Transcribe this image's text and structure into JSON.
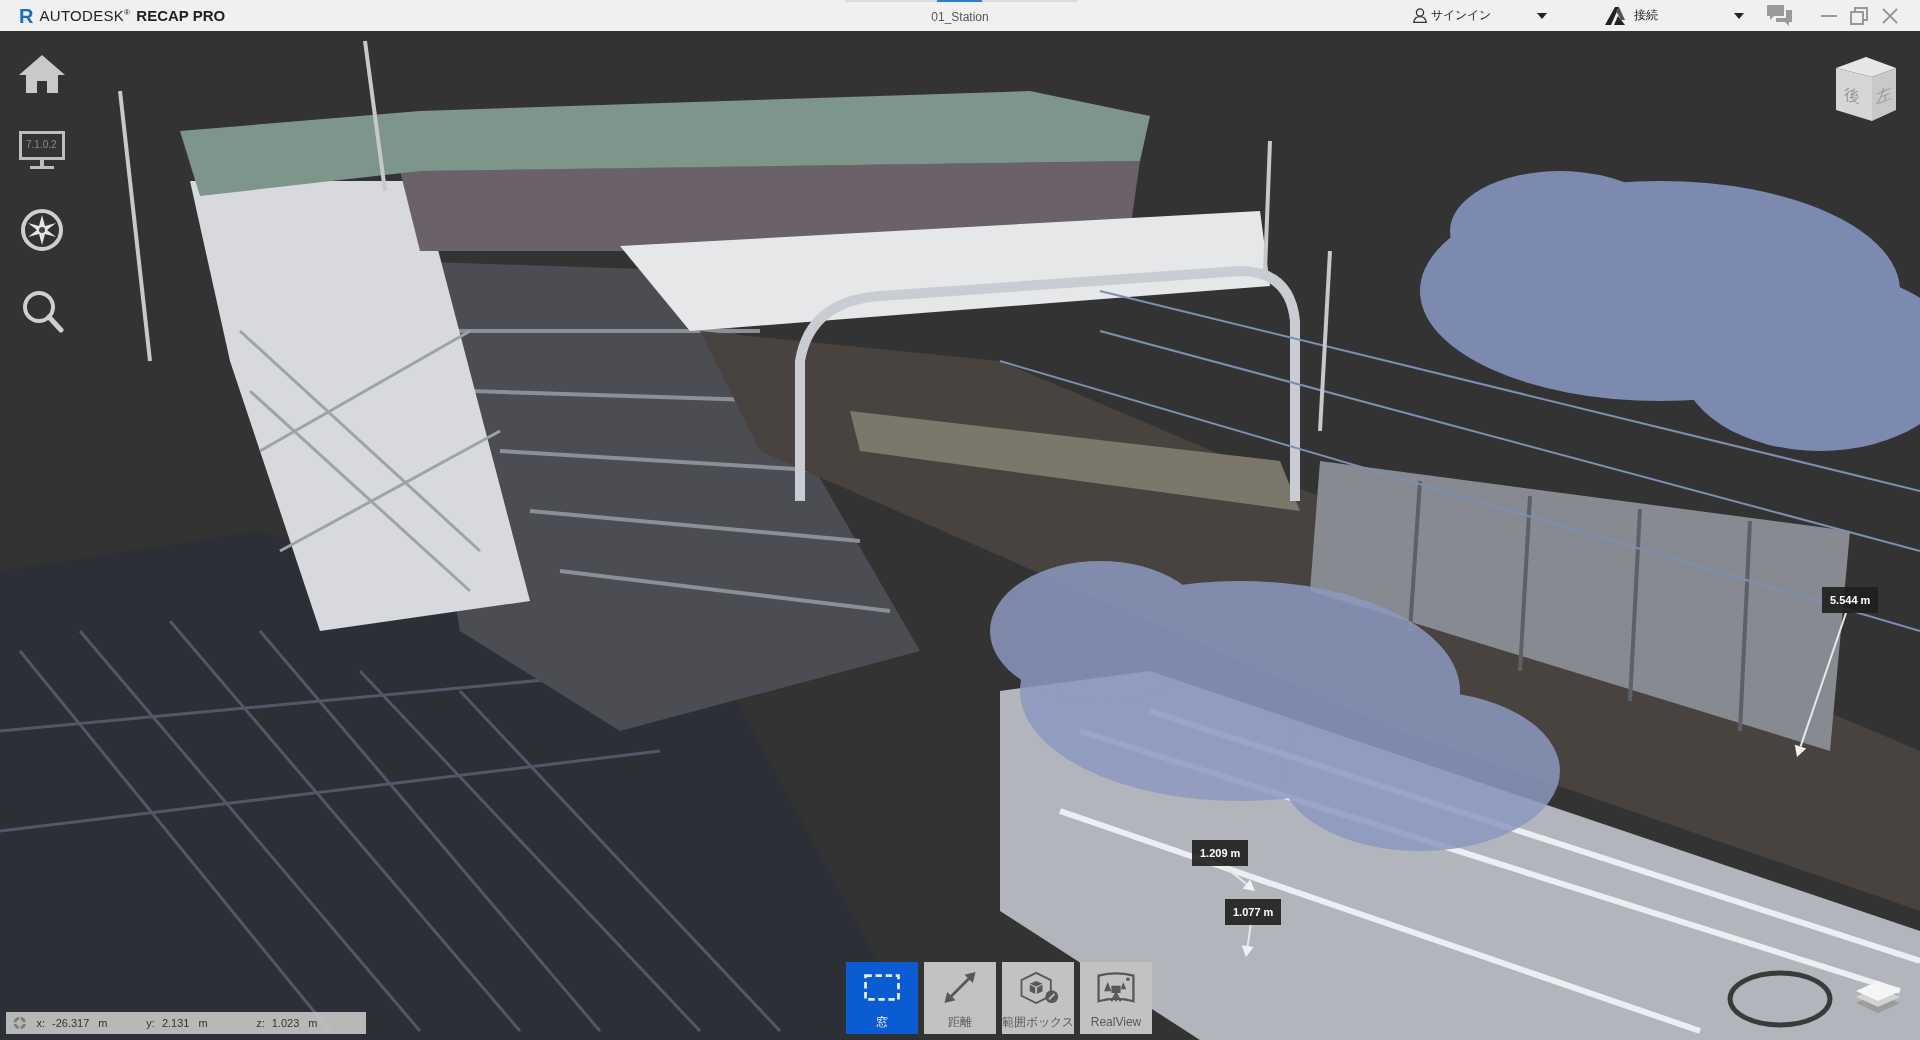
{
  "app": {
    "logo": "R",
    "brand": "AUTODESK$^{®}$",
    "product": "RECAP PRO"
  },
  "window": {
    "title": "01_Station"
  },
  "account": {
    "sign_in": "サインイン",
    "connect": "接続"
  },
  "navigation": {
    "display_label": "7.1.0.2"
  },
  "view_cube": {
    "faces": [
      "後",
      "左"
    ]
  },
  "measurements": [
    {
      "value": "5.544 m"
    },
    {
      "value": "1.209 m"
    },
    {
      "value": "1.077 m"
    }
  ],
  "tools": [
    {
      "label": "窓",
      "kind": "window",
      "selected": true
    },
    {
      "label": "距離",
      "kind": "distance",
      "selected": false
    },
    {
      "label": "範囲ボックス",
      "kind": "limit-box",
      "selected": false
    },
    {
      "label": "RealView",
      "kind": "realview",
      "selected": false
    }
  ],
  "coordinates": [
    {
      "axis": "x:",
      "value": "-26.317",
      "unit": "m"
    },
    {
      "axis": "y:",
      "value": "2.131",
      "unit": "m"
    },
    {
      "axis": "z:",
      "value": "1.023",
      "unit": "m"
    }
  ]
}
